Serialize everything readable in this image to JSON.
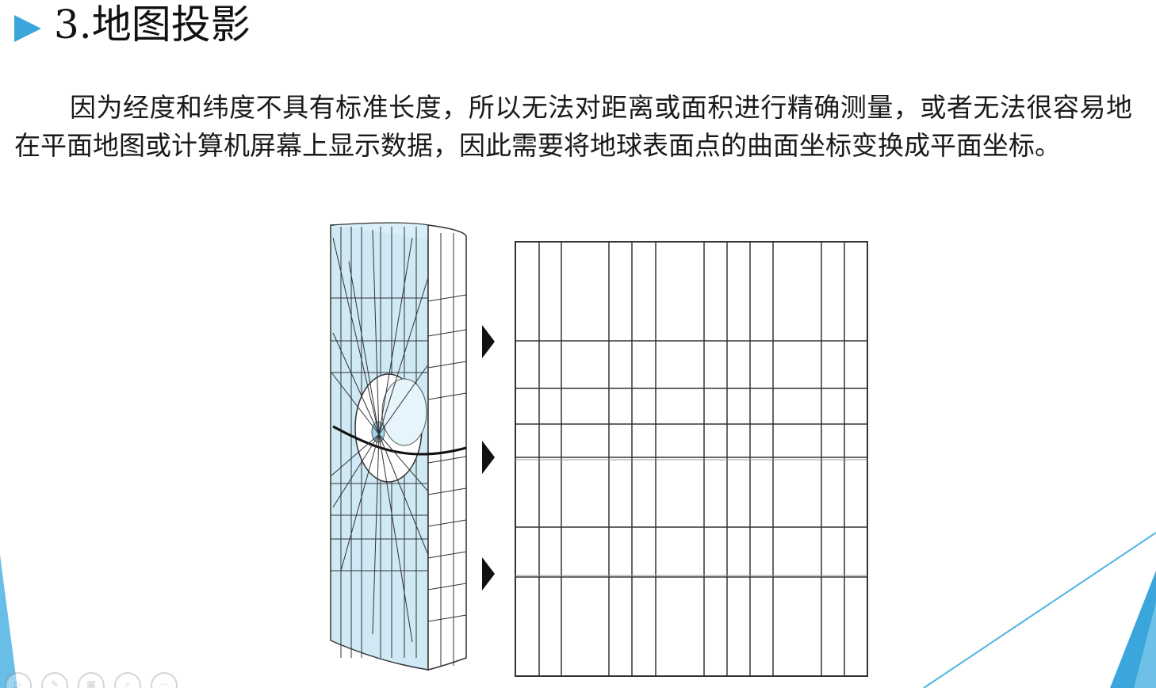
{
  "slide": {
    "title": "3.地图投影",
    "body": "因为经度和纬度不具有标准长度，所以无法对距离或面积进行精确测量，或者无法很容易地在平面地图或计算机屏幕上显示数据，因此需要将地球表面点的曲面坐标变换成平面坐标。"
  },
  "colors": {
    "accent": "#3aa6dc",
    "cylinder_fill": "#cfe9f5",
    "grid_line": "#333333",
    "text": "#1a1a1a"
  },
  "icons": {
    "title_bullet": "triangle-right-icon",
    "projection_arrow": "triangle-right-icon",
    "toolbar": [
      "play-icon",
      "pen-icon",
      "grid-icon",
      "zoom-icon",
      "more-icon"
    ]
  }
}
